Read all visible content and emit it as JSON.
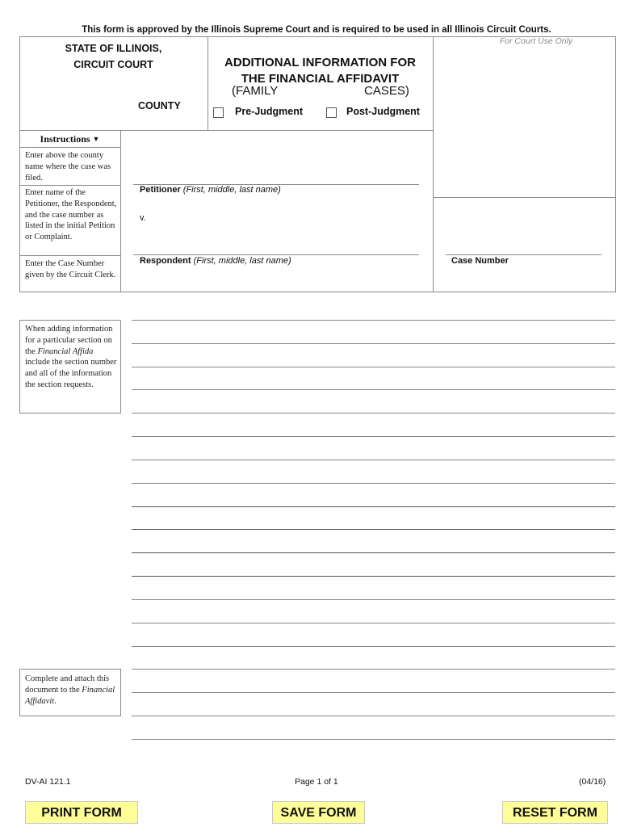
{
  "approval_notice": "This form is approved by the Illinois Supreme Court and is required to be used in all Illinois Circuit Courts.",
  "header": {
    "state": "STATE OF ILLINOIS,",
    "court": "CIRCUIT COURT",
    "county_label": "COUNTY",
    "county_value": "",
    "title_line1": "ADDITIONAL INFORMATION FOR",
    "title_line2": "THE FINANCIAL AFFIDAVIT",
    "subtitle_left": "(FAMILY",
    "subtitle_right": "CASES)",
    "checkboxes": [
      {
        "label": "Pre-Judgment",
        "checked": false
      },
      {
        "label": "Post-Judgment",
        "checked": false
      }
    ],
    "court_use_label": "For Court Use Only"
  },
  "instructions": {
    "header": "Instructions",
    "header_icon": "caret-down-icon",
    "items": [
      "Enter above the county name where the case was filed.",
      "Enter name of the Petitioner, the Respondent, and the case number as listed in the initial Petition or Complaint.",
      "Enter the Case Number given by the Circuit Clerk."
    ],
    "section_note_pre": "When adding information for a particular section on the ",
    "section_note_italic": "Financial Affida",
    "section_note_post": " include the section number and all of the information the section requests.",
    "attach_note_pre": "Complete and attach this document to the ",
    "attach_note_italic": "Financial Affidavit",
    "attach_note_post": "."
  },
  "parties": {
    "petitioner_label": "Petitioner",
    "petitioner_hint": "(First, middle, last name)",
    "petitioner_value": "",
    "versus": "v.",
    "respondent_label": "Respondent",
    "respondent_hint": "(First, middle, last name)",
    "respondent_value": "",
    "case_number_label": "Case Number",
    "case_number_value": ""
  },
  "info_lines": [
    "",
    "",
    "",
    "",
    "",
    "",
    "",
    "",
    "",
    "",
    "",
    "",
    "",
    "",
    "",
    "",
    "",
    "",
    ""
  ],
  "footer": {
    "form_id": "DV-AI 121.1",
    "page": "Page 1 of 1",
    "revision": "(04/16)"
  },
  "buttons": {
    "print": "PRINT FORM",
    "save": "SAVE FORM",
    "reset": "RESET FORM",
    "fill_color": "#ffff99"
  }
}
